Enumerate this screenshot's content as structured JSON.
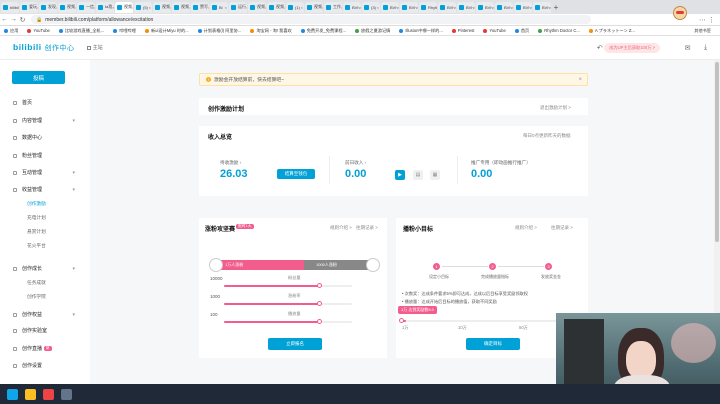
{
  "browser": {
    "tabs": [
      {
        "label": "bilibili"
      },
      {
        "label": "爱玩"
      },
      {
        "label": "发现"
      },
      {
        "label": "视频"
      },
      {
        "label": "一信"
      },
      {
        "label": "ta我"
      },
      {
        "label": "视频"
      },
      {
        "label": "(5)"
      },
      {
        "label": "视频"
      },
      {
        "label": "视频"
      },
      {
        "label": "赞写"
      },
      {
        "label": "Bi"
      },
      {
        "label": "运行"
      },
      {
        "label": "视频"
      },
      {
        "label": "视频"
      },
      {
        "label": "(1)"
      },
      {
        "label": "视频"
      },
      {
        "label": "工作"
      },
      {
        "label": "BVh"
      },
      {
        "label": "(3)"
      },
      {
        "label": "BVh"
      },
      {
        "label": "BVh"
      },
      {
        "label": "Rhythm"
      },
      {
        "label": "BVh"
      },
      {
        "label": "BVh"
      },
      {
        "label": "BVh"
      },
      {
        "label": "BVh"
      },
      {
        "label": "BVh"
      },
      {
        "label": "BVh"
      }
    ],
    "url": "member.bilibili.com/platform/allowance/excitation",
    "bookmarks": [
      {
        "label": "应用",
        "color": "b"
      },
      {
        "label": "YouTube",
        "color": ""
      },
      {
        "label": "比较游戏直播_全机...",
        "color": "b"
      },
      {
        "label": "哔哩哔哩",
        "color": "b"
      },
      {
        "label": "新ui设计Miyu 时的...",
        "color": "o"
      },
      {
        "label": "计划表格(l) 阿里协...",
        "color": "b"
      },
      {
        "label": "淘宝网 - 淘! 我喜欢",
        "color": "o"
      },
      {
        "label": "免费开发_免费课程...",
        "color": "b"
      },
      {
        "label": "放假之夏游记情",
        "color": "g"
      },
      {
        "label": "Illusion中哪一样的...",
        "color": "b"
      },
      {
        "label": "Pinterest",
        "color": ""
      },
      {
        "label": "YouTube",
        "color": ""
      },
      {
        "label": "首页",
        "color": "b"
      },
      {
        "label": "Rhythm Doctor C...",
        "color": "g"
      },
      {
        "label": "A プラネットーン Z...",
        "color": "o"
      }
    ],
    "bookmarks_other": "其他书签"
  },
  "header": {
    "logo": "bilibili",
    "logo_sub": "创作中心",
    "home_label": "主站",
    "promo_pill": "成为UP主后获取100万 >"
  },
  "sidebar": {
    "upload_label": "投稿",
    "items": [
      {
        "label": "首页",
        "chev": ""
      },
      {
        "label": "内容管理",
        "chev": "▾"
      },
      {
        "label": "数据中心",
        "chev": ""
      },
      {
        "label": "粉丝管理",
        "chev": ""
      },
      {
        "label": "互动管理",
        "chev": "▾"
      },
      {
        "label": "收益管理",
        "chev": "▾"
      }
    ],
    "earnings_sub": [
      "创作激励",
      "充电计划",
      "悬赏计划",
      "花火平台"
    ],
    "growth_label": "创作成长",
    "growth_sub": [
      "任务成就",
      "创作学院"
    ],
    "rights_label": "创作权益",
    "lab_label": "创作实验室",
    "live_label": "创作直播",
    "new_tag": "新",
    "settings_label": "创作设置"
  },
  "notice": {
    "text": "激励金开放结算前，快去结算吧~"
  },
  "plan": {
    "title": "创作激励计划",
    "exit_link": "退出激励计划 >"
  },
  "income": {
    "title": "收入总览",
    "update_note": "每日0点更新昨天的数据",
    "balance_label": "待收激励 ›",
    "balance_value": "26.03",
    "withdraw_btn": "结算至钱包",
    "yesterday_label": "前日收入 ›",
    "yesterday_value": "0.00",
    "reward_label": "推广专用（即动画推行推广）",
    "reward_value": "0.00"
  },
  "bonus": {
    "title": "涨粉攻坚赛",
    "tag": "限时1天",
    "rules": "规则介绍 >",
    "history": "往期记录 >",
    "left_chip": "1万人涨粉",
    "right_chip": "1000人涨粉",
    "rows": [
      {
        "value": "10000",
        "label": "粉丝量",
        "progress": 0.74
      },
      {
        "value": "1000",
        "label": "涨粉率",
        "progress": 0.74
      },
      {
        "value": "100",
        "label": "播放量",
        "progress": 0.74
      }
    ],
    "btn": "立即报名"
  },
  "goal": {
    "title": "播粉小目标",
    "rules": "规则介绍 >",
    "history": "往期记录 >",
    "steps": [
      {
        "num": "1",
        "label": "设定小目标"
      },
      {
        "num": "2",
        "label": "完成播放量指标"
      },
      {
        "num": "3",
        "label": "发放奖金金"
      }
    ],
    "notes": [
      "• 次数奖：达成条件要求5%即可达成，达成以后目标享受奖励领取权",
      "• 播放量：达成开始后目标的播放值，获取不同奖励"
    ],
    "slider_chip": "1万 达到奖励数5.0",
    "ticks": [
      "1万",
      "10万",
      "50万"
    ],
    "btn": "确定目标"
  }
}
